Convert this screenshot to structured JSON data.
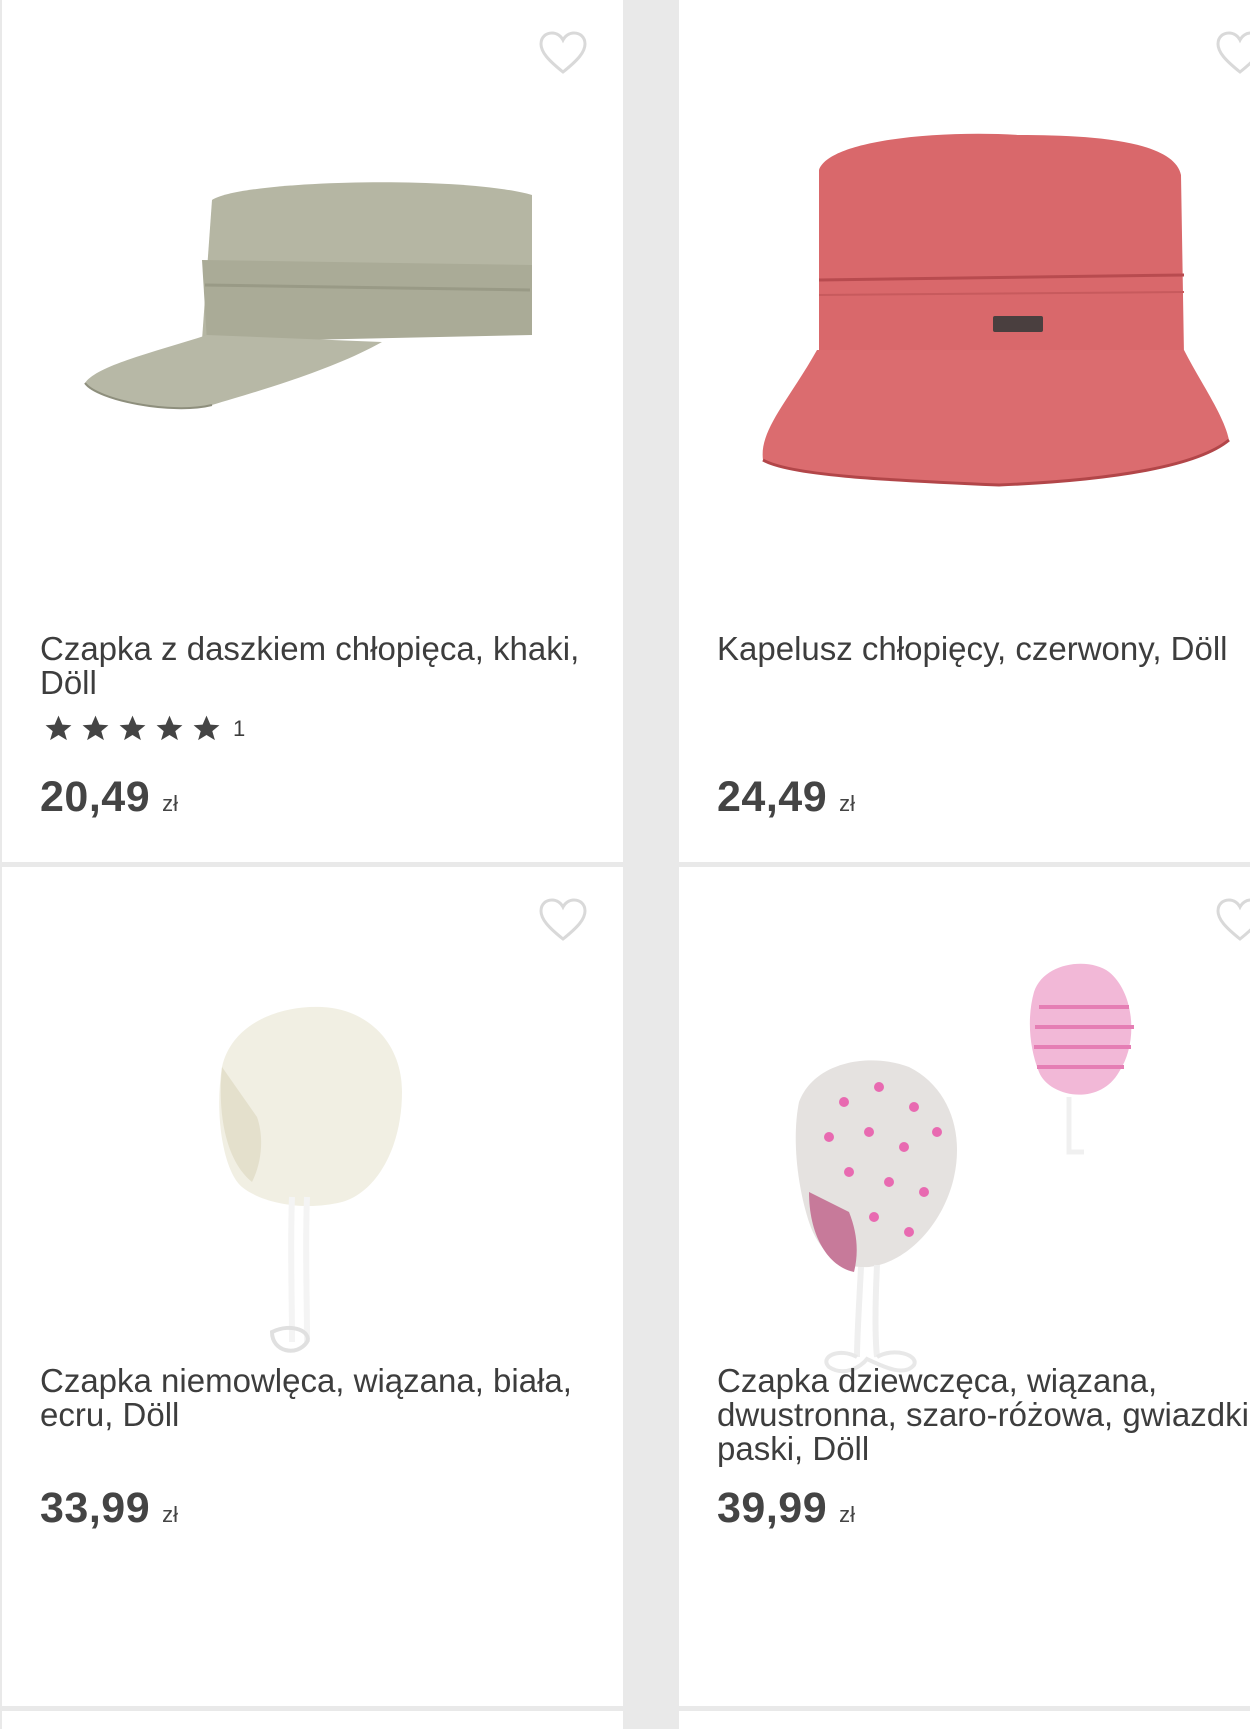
{
  "products": [
    {
      "title": "Czapka z daszkiem chłopięca, khaki, Döll",
      "rating_count": "1",
      "stars": 5,
      "price": "20,49",
      "currency": "zł",
      "image_icon": "khaki-cap-image"
    },
    {
      "title": "Kapelusz chłopięcy, czerwony, Döll",
      "price": "24,49",
      "currency": "zł",
      "image_icon": "red-bucket-hat-image"
    },
    {
      "title": "Czapka niemowlęca, wiązana, biała, ecru, Döll",
      "price": "33,99",
      "currency": "zł",
      "image_icon": "white-baby-bonnet-image"
    },
    {
      "title": "Czapka dziewczęca, wiązana, dwustronna, szaro-różowa, gwiazdki, paski, Döll",
      "price": "39,99",
      "currency": "zł",
      "image_icon": "pink-star-bonnets-image"
    }
  ],
  "favorite_icon": "heart-outline-icon",
  "colors": {
    "text": "#3d3d3d",
    "star": "#444444",
    "heart": "#d9d9d9",
    "background": "#e9e9e9"
  }
}
